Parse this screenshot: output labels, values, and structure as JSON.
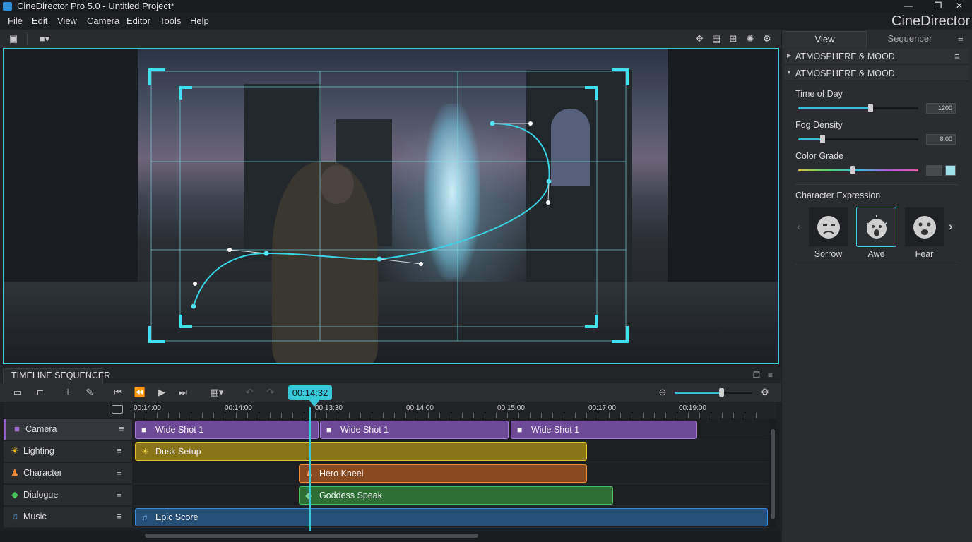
{
  "app": {
    "title": "CineDirector Pro 5.0 - Untitled Project*",
    "brand": "CineDirector"
  },
  "window_controls": {
    "minimize": "—",
    "maximize": "❐",
    "close": "✕"
  },
  "menu": [
    "File",
    "Edit",
    "View",
    "Camera",
    "Editor",
    "Tools",
    "Help"
  ],
  "right_panel": {
    "tabs": [
      "View",
      "Sequencer"
    ],
    "sections": [
      "ATMOSPHERE & MOOD",
      "ATMOSPHERE & MOOD"
    ],
    "sliders": [
      {
        "label": "Time of Day",
        "value": "1200",
        "level": 0.6
      },
      {
        "label": "Fog Density",
        "value": "8.00",
        "level": 0.2
      },
      {
        "label": "Color Grade",
        "value": "",
        "level": 0.45
      }
    ],
    "color_grade_swatch": "#9fe2ea",
    "expression_title": "Character Expression",
    "expressions": [
      {
        "label": "Sorrow",
        "selected": false
      },
      {
        "label": "Awe",
        "selected": true
      },
      {
        "label": "Fear",
        "selected": false
      }
    ]
  },
  "timeline": {
    "tab_label": "TIMELINE SEQUENCER",
    "timecode": "00:14:32",
    "zoom_level": 0.6,
    "ruler_ticks": [
      "00:14:00",
      "00:14:00",
      "00:13:30",
      "00:14:00",
      "00:15:00",
      "00:17:00",
      "00:19:00"
    ],
    "tracks": [
      {
        "name": "Camera",
        "color": "#8f5fc4"
      },
      {
        "name": "Lighting",
        "color": "#f0c419"
      },
      {
        "name": "Character",
        "color": "#ef8a3b"
      },
      {
        "name": "Dialogue",
        "color": "#4bbf5a"
      },
      {
        "name": "Music",
        "color": "#3d8ad6"
      }
    ],
    "clips": {
      "camera": [
        "Wide Shot 1",
        "Wide Shot 1",
        "Wide Shot 1"
      ],
      "lighting": "Dusk Setup",
      "character": "Hero Kneel",
      "dialogue": "Goddess Speak",
      "music": "Epic Score"
    }
  }
}
